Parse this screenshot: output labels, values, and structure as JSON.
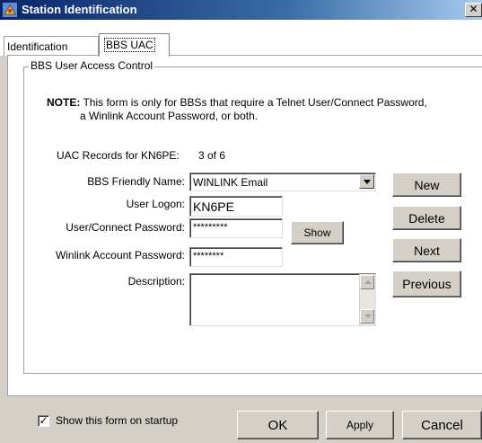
{
  "window": {
    "title": "Station Identification",
    "close_glyph": "✕"
  },
  "tabs": [
    {
      "label": "Identification",
      "active": false
    },
    {
      "label": "BBS UAC",
      "active": true
    }
  ],
  "group": {
    "legend": "BBS User Access Control",
    "note_prefix": "NOTE:",
    "note_line1": "This form is only for BBSs that require a Telnet User/Connect Password,",
    "note_line2": "a Winlink Account Password, or both."
  },
  "records": {
    "label": "UAC Records for KN6PE:",
    "value": "3 of 6"
  },
  "form": {
    "friendly_name_label": "BBS Friendly Name:",
    "friendly_name_value": "WINLINK Email",
    "user_logon_label": "User Logon:",
    "user_logon_value": "KN6PE",
    "connect_pw_label": "User/Connect Password:",
    "connect_pw_value": "*********",
    "winlink_pw_label": "Winlink Account Password:",
    "winlink_pw_value": "********",
    "description_label": "Description:",
    "description_value": "",
    "show_label": "Show"
  },
  "side_buttons": {
    "new": "New",
    "delete": "Delete",
    "next": "Next",
    "previous": "Previous"
  },
  "footer": {
    "startup_label": "Show this form on startup",
    "startup_checked": true,
    "check_glyph": "✓",
    "ok": "OK",
    "apply": "Apply",
    "cancel": "Cancel"
  }
}
